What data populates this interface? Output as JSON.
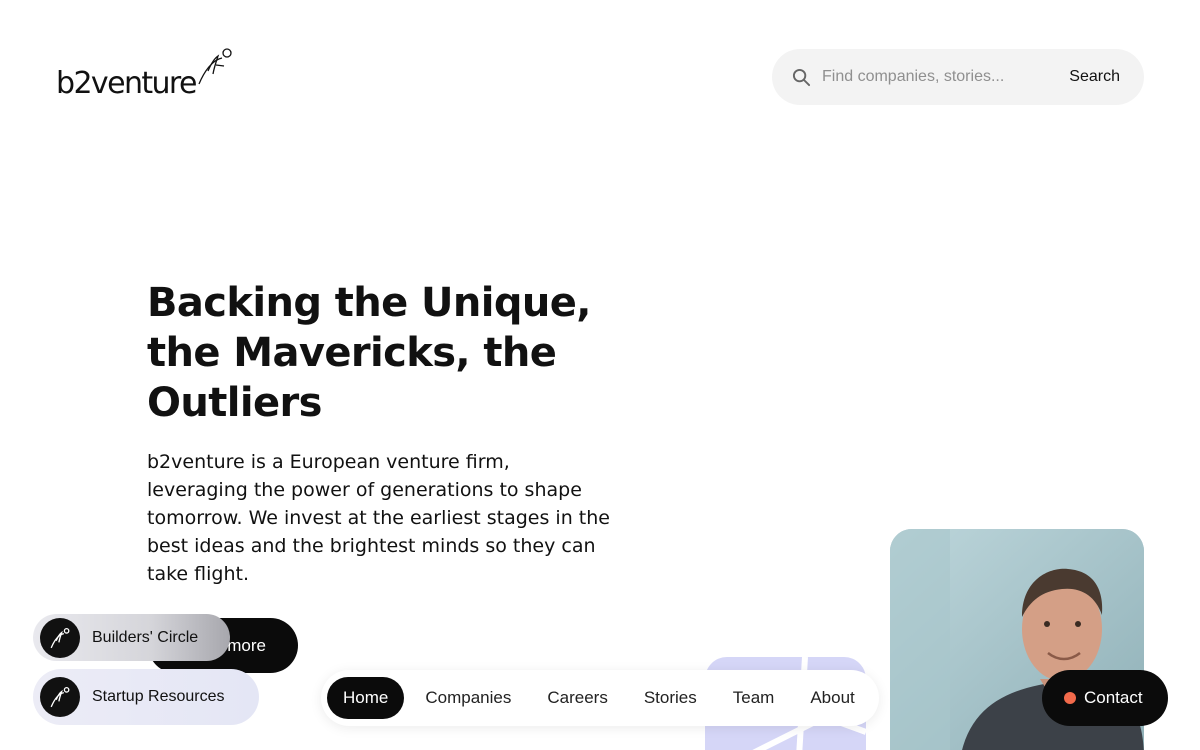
{
  "brand": {
    "name": "b2venture"
  },
  "search": {
    "placeholder": "Find companies, stories...",
    "button_label": "Search"
  },
  "hero": {
    "title": "Backing the Unique, the Mavericks, the Outliers",
    "description": "b2venture is a European venture firm, leveraging the power of generations to shape tomorrow. We invest at the earliest stages in the best ideas and the brightest minds so they can take flight.",
    "cta_label_visible": "more"
  },
  "side_links": [
    {
      "label": "Builders' Circle",
      "icon": "b2venture-mark-icon"
    },
    {
      "label": "Startup Resources",
      "icon": "b2venture-mark-icon"
    }
  ],
  "nav": {
    "items": [
      {
        "label": "Home",
        "active": true
      },
      {
        "label": "Companies",
        "active": false
      },
      {
        "label": "Careers",
        "active": false
      },
      {
        "label": "Stories",
        "active": false
      },
      {
        "label": "Team",
        "active": false
      },
      {
        "label": "About",
        "active": false
      }
    ]
  },
  "contact": {
    "label": "Contact",
    "dot_color": "#f26a4b"
  },
  "colors": {
    "primary": "#0b0b0b",
    "accent": "#f26a4b",
    "card_lilac": "#d5d6f7"
  }
}
